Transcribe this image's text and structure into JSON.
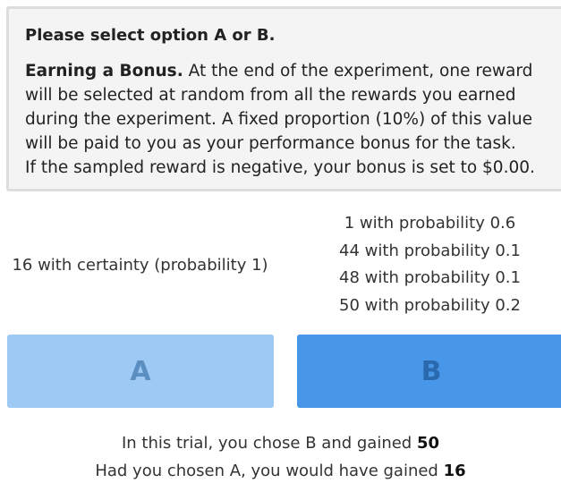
{
  "instructions": {
    "title": "Please select option A or B.",
    "bonus_heading": "Earning a Bonus.",
    "bonus_line1": " At the end of the experiment, one reward",
    "bonus_line2": "will be selected at random from all the rewards you earned",
    "bonus_line3": "during the experiment. A fixed proportion (10%) of this value",
    "bonus_line4": "will be paid to you as your performance bonus for the task.",
    "bonus_line5": "If the sampled reward is negative, your bonus is set to $0.00."
  },
  "option_a": {
    "description": "16 with certainty (probability 1)"
  },
  "option_b": {
    "outcomes": [
      "1 with probability 0.6",
      "44 with probability 0.1",
      "48 with probability 0.1",
      "50 with probability 0.2"
    ]
  },
  "buttons": {
    "a_label": "A",
    "b_label": "B",
    "a_color": "#9dc9f4",
    "b_color": "#4896e8"
  },
  "feedback": {
    "line1_prefix": "In this trial, you chose ",
    "line1_choice": "B",
    "line1_mid": " and gained ",
    "line1_value": "50",
    "line2_prefix": "Had you chosen ",
    "line2_choice": "A",
    "line2_mid": ", you would have gained ",
    "line2_value": "16"
  }
}
